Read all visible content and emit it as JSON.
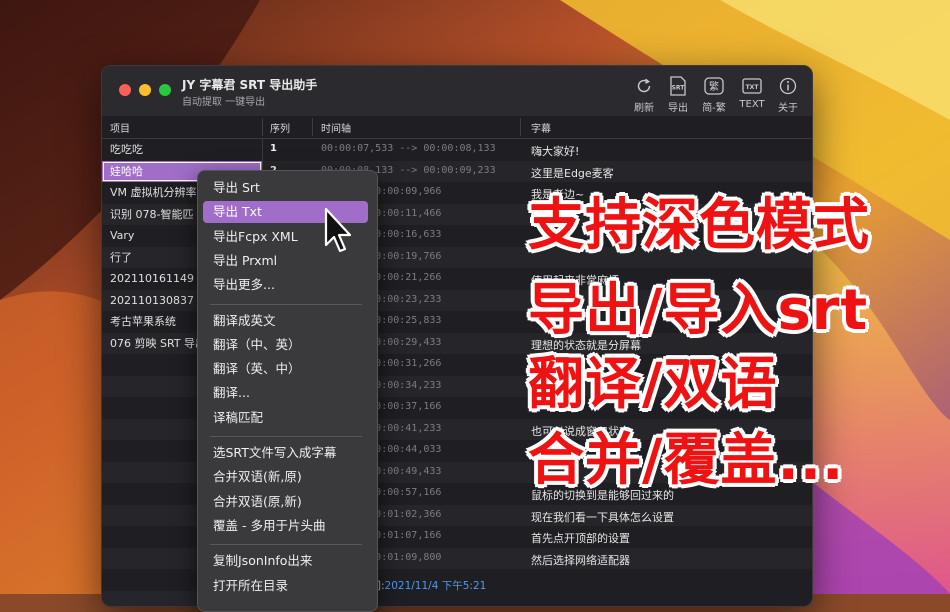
{
  "window": {
    "title": "JY 字幕君 SRT 导出助手",
    "subtitle": "自动提取 一键导出"
  },
  "toolbar": [
    {
      "label": "刷新",
      "icon": "refresh-icon"
    },
    {
      "label": "导出",
      "icon": "srt-file-icon",
      "glyph": "SRT"
    },
    {
      "label": "简-繁",
      "icon": "traditional-chinese-icon",
      "glyph": "繁"
    },
    {
      "label": "TEXT",
      "icon": "text-file-icon",
      "glyph": "TXT"
    },
    {
      "label": "关于",
      "icon": "info-icon"
    }
  ],
  "columns": {
    "project": "项目",
    "index": "序列",
    "timeline": "时间轴",
    "subtitle": "字幕"
  },
  "projects": [
    {
      "name": "吃吃吃"
    },
    {
      "name": "娃哈哈",
      "selected": true
    },
    {
      "name": "VM 虚拟机分辨率"
    },
    {
      "name": "识别 078-智能匹"
    },
    {
      "name": "Vary"
    },
    {
      "name": "行了"
    },
    {
      "name": "202110161149"
    },
    {
      "name": "202110130837"
    },
    {
      "name": "考古苹果系统"
    },
    {
      "name": "076 剪映 SRT 导出"
    }
  ],
  "subtitles": [
    {
      "no": "1",
      "time": "00:00:07,533 --> 00:00:08,133",
      "text": "嗨大家好!"
    },
    {
      "no": "2",
      "time": "00:00:08,133 --> 00:00:09,233",
      "text": "这里是Edge麦客"
    },
    {
      "no": "",
      "time": "200 --> 00:00:09,966",
      "text": "我是老边~"
    },
    {
      "no": "",
      "time": "766 --> 00:00:11,466",
      "text": ""
    },
    {
      "no": "",
      "time": "766 --> 00:00:16,633",
      "text": ""
    },
    {
      "no": "",
      "time": "766 --> 00:00:19,766",
      "text": ""
    },
    {
      "no": "",
      "time": "766 --> 00:00:21,266",
      "text": "使用起来非常麻烦"
    },
    {
      "no": "",
      "time": "200 --> 00:00:23,233",
      "text": ""
    },
    {
      "no": "",
      "time": "200 --> 00:00:25,833",
      "text": ""
    },
    {
      "no": "",
      "time": "833 --> 00:00:29,433",
      "text": "理想的状态就是分屏幕"
    },
    {
      "no": "",
      "time": "200 --> 00:00:31,266",
      "text": ""
    },
    {
      "no": "",
      "time": "766 --> 00:00:34,233",
      "text": ""
    },
    {
      "no": "",
      "time": "766 --> 00:00:37,166",
      "text": ""
    },
    {
      "no": "",
      "time": "766 --> 00:00:41,233",
      "text": "也可以说成窗口状态"
    },
    {
      "no": "",
      "time": "200 --> 00:00:44,033",
      "text": ""
    },
    {
      "no": "",
      "time": "433 --> 00:00:49,433",
      "text": ""
    },
    {
      "no": "",
      "time": "200 --> 00:00:57,166",
      "text": "鼠标的切换到是能够回过来的"
    },
    {
      "no": "",
      "time": "366 --> 00:01:02,366",
      "text": "现在我们看一下具体怎么设置"
    },
    {
      "no": "",
      "time": "366 --> 00:01:07,166",
      "text": "首先点开顶部的设置"
    },
    {
      "no": "",
      "time": "800 --> 00:01:09,800",
      "text": "然后选择网络适配器"
    }
  ],
  "status": {
    "label": "时间:",
    "value": "2021/11/4 下午5:21"
  },
  "context_menu": [
    {
      "label": "导出 Srt"
    },
    {
      "label": "导出 Txt",
      "highlighted": true
    },
    {
      "label": "导出Fcpx XML"
    },
    {
      "label": "导出 Prxml"
    },
    {
      "label": "导出更多..."
    },
    {
      "sep": true
    },
    {
      "label": "翻译成英文"
    },
    {
      "label": "翻译（中、英）"
    },
    {
      "label": "翻译（英、中）"
    },
    {
      "label": "翻译..."
    },
    {
      "label": "译稿匹配"
    },
    {
      "sep": true
    },
    {
      "label": "选SRT文件写入成字幕"
    },
    {
      "label": "合并双语(新,原)"
    },
    {
      "label": "合并双语(原,新)"
    },
    {
      "label": "覆盖 - 多用于片头曲"
    },
    {
      "sep": true
    },
    {
      "label": "复制JsonInfo出来"
    },
    {
      "label": "打开所在目录"
    }
  ],
  "overlay_text": [
    "支持深色模式",
    "导出/导入srt",
    "翻译/双语",
    "合并/覆盖..."
  ],
  "colors": {
    "accent": "#a06ec8",
    "overlay_red": "#ee1212",
    "status_value": "#4a9cf0"
  }
}
